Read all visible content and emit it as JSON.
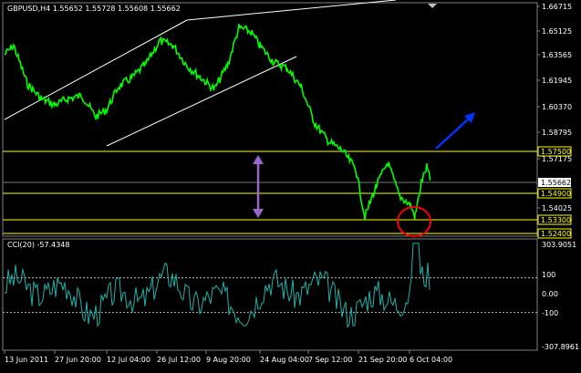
{
  "price_panel": {
    "symbol_info": "GBPUSD,H4  1.55652 1.55728 1.55608 1.55662",
    "price_ticks": [
      "1.66715",
      "1.65125",
      "1.63565",
      "1.61945",
      "1.60370",
      "1.58795",
      "1.57175",
      "1.54025"
    ],
    "horizontal_levels": [
      {
        "label": "1.57500",
        "value": 1.575
      },
      {
        "label": "1.54900",
        "value": 1.549
      },
      {
        "label": "1.53300",
        "value": 1.533
      },
      {
        "label": "1.52400",
        "value": 1.524
      }
    ],
    "current_price": {
      "label": "1.55662",
      "value": 1.55662
    },
    "colors": {
      "candles": "#00ff00",
      "level_lines": "#ffff00",
      "current_price_line": "#888888",
      "channel": "#ffffff",
      "range_arrow": "#9966cc",
      "trend_arrow": "#0033ff",
      "marker_circle": "#ff0000",
      "cci": "#20b2aa"
    }
  },
  "cci_panel": {
    "title": "CCI(20) -57.4348",
    "ticks": [
      "303.9051",
      "100",
      "0.00",
      "-100",
      "-307.8961"
    ],
    "levels": [
      100,
      -100
    ]
  },
  "time_axis": [
    "13 Jun 2011",
    "27 Jun 20:00",
    "12 Jul 04:00",
    "26 Jul 12:00",
    "9 Aug 20:00",
    "24 Aug 04:00",
    "7 Sep 12:00",
    "21 Sep 20:00",
    "6 Oct 04:00"
  ],
  "chart_data": {
    "type": "line",
    "title": "GBPUSD,H4",
    "y_range": [
      1.524,
      1.66715
    ],
    "price_path": [
      {
        "t": "13 Jun 2011",
        "v": 1.64
      },
      {
        "t": "27 Jun 20:00",
        "v": 1.604
      },
      {
        "t": "12 Jul 04:00",
        "v": 1.608
      },
      {
        "t": "26 Jul 12:00",
        "v": 1.641
      },
      {
        "t": "9 Aug 20:00",
        "v": 1.627
      },
      {
        "t": "24 Aug 04:00",
        "v": 1.64
      },
      {
        "t": "7 Sep 12:00",
        "v": 1.582
      },
      {
        "t": "21 Sep 20:00",
        "v": 1.533
      },
      {
        "t": "6 Oct 04:00",
        "v": 1.556
      }
    ],
    "cci_range": [
      -307.8961,
      303.9051
    ]
  }
}
